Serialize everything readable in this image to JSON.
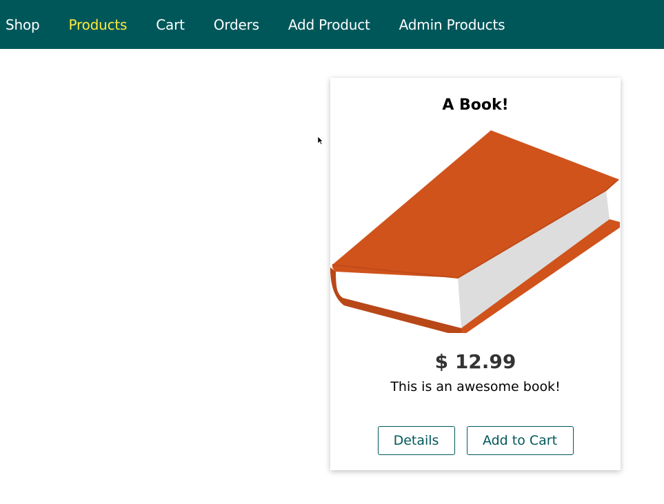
{
  "nav": {
    "items": [
      {
        "label": "Shop",
        "active": false
      },
      {
        "label": "Products",
        "active": true
      },
      {
        "label": "Cart",
        "active": false
      },
      {
        "label": "Orders",
        "active": false
      },
      {
        "label": "Add Product",
        "active": false
      },
      {
        "label": "Admin Products",
        "active": false
      }
    ]
  },
  "product": {
    "title": "A Book!",
    "image_icon": "book-icon",
    "price": "$ 12.99",
    "description": "This is an awesome book!",
    "details_label": "Details",
    "add_to_cart_label": "Add to Cart"
  },
  "colors": {
    "header_bg": "#00575a",
    "active_nav": "#ffeb3b",
    "accent": "#00575a",
    "book_cover": "#d0531c"
  }
}
